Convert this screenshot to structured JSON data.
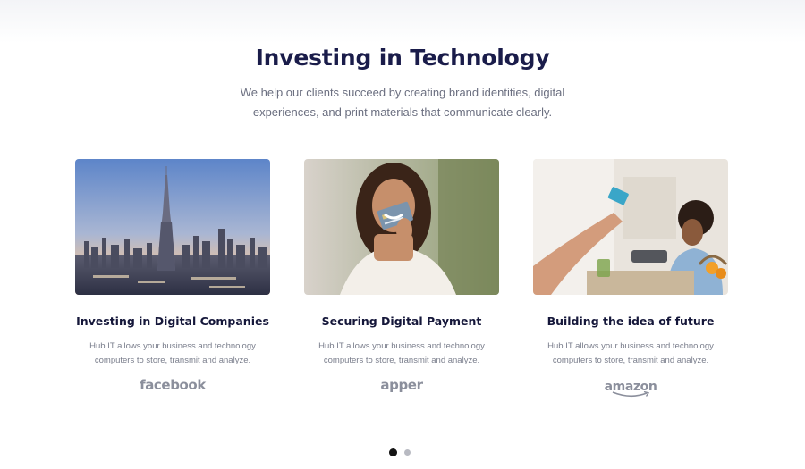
{
  "section": {
    "title": "Investing in Technology",
    "subtitle": "We help our clients succeed by creating brand identities, digital experiences, and print materials that communicate clearly."
  },
  "cards": [
    {
      "heading": "Investing in Digital Companies",
      "description": "Hub IT allows your business and technology computers to store, transmit and analyze.",
      "logo": "facebook",
      "image": "city-skyline-photo"
    },
    {
      "heading": "Securing Digital Payment",
      "description": "Hub IT allows your business and technology computers to store, transmit and analyze.",
      "logo": "apper",
      "image": "woman-holding-card-photo"
    },
    {
      "heading": "Building the idea of future",
      "description": "Hub IT allows your business and technology computers to store, transmit and analyze.",
      "logo": "amazon",
      "image": "card-payment-photo"
    }
  ],
  "carousel": {
    "active_index": 0,
    "total": 2
  },
  "colors": {
    "title": "#1a1c4a",
    "body_text": "#6b6f80",
    "logo_gray": "#8b8f9c",
    "dot_active": "#141414",
    "dot_inactive": "#b8bac2"
  }
}
